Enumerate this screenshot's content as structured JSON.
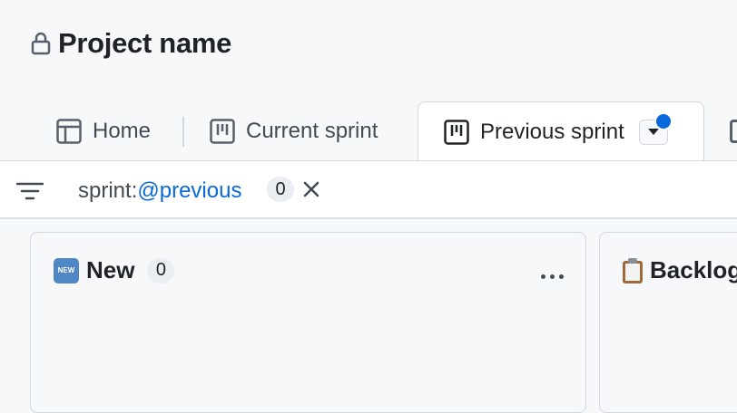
{
  "header": {
    "title": "Project name",
    "icon": "lock-icon"
  },
  "tabs": [
    {
      "label": "Home",
      "icon": "table-icon",
      "active": false
    },
    {
      "label": "Current sprint",
      "icon": "board-icon",
      "active": false
    },
    {
      "label": "Previous sprint",
      "icon": "board-icon",
      "active": true
    }
  ],
  "filter": {
    "key": "sprint:",
    "value": "@previous",
    "count": "0"
  },
  "columns": [
    {
      "emoji": "🆕",
      "emoji_text": "NEW",
      "name": "New",
      "count": "0"
    },
    {
      "emoji": "📋",
      "name": "Backlog"
    }
  ],
  "colors": {
    "accent": "#0969da",
    "canvas": "#f6f8fa",
    "border": "#d0d7de"
  }
}
